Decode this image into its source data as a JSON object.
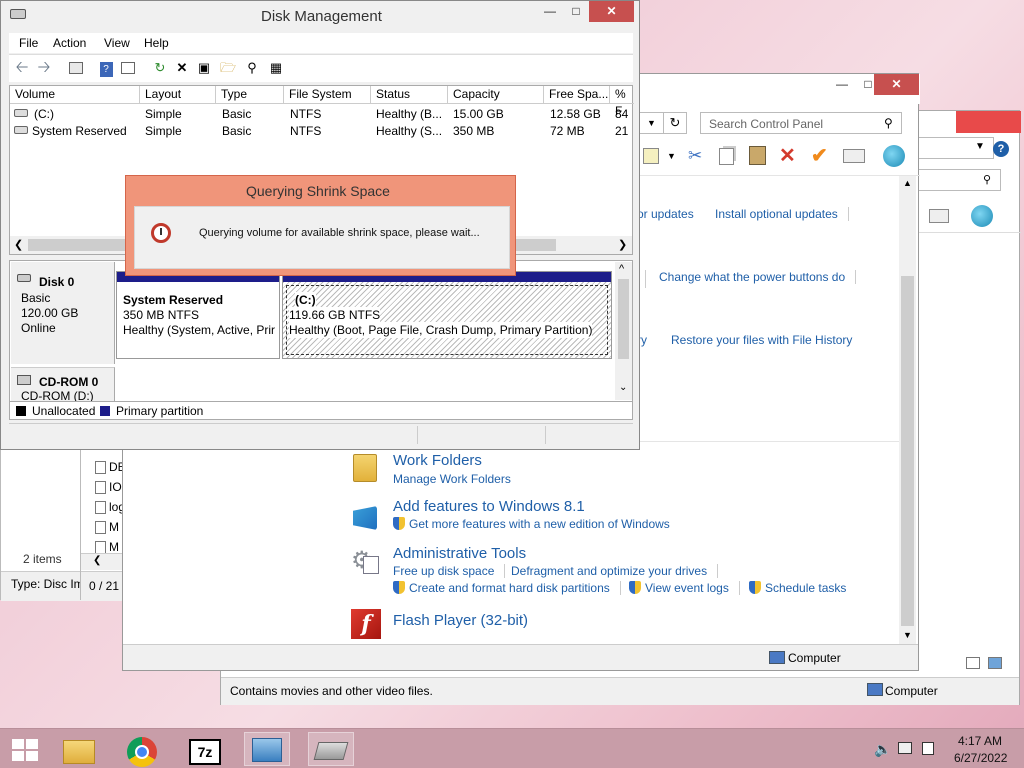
{
  "background_windows": {
    "left_explorer": {
      "items_count": "2 items",
      "type_text": "Type: Disc Im"
    },
    "middle_explorer": {
      "file_labels": [
        "DE",
        "IO",
        "log",
        "M",
        "M"
      ],
      "count_text": "0 / 21"
    },
    "back_control_panel": {
      "status_text": "Contains movies and other video files.",
      "computer_label": "Computer"
    }
  },
  "control_panel": {
    "search_placeholder": "Search Control Panel",
    "links_row1": [
      "or updates",
      "Install optional updates"
    ],
    "link_row2": "Change what the power buttons do",
    "links_row3": [
      "ry",
      "Restore your files with File History"
    ],
    "sections": [
      {
        "title": "Work Folders",
        "links": [
          "Manage Work Folders"
        ]
      },
      {
        "title": "Add features to Windows 8.1",
        "links": [
          "Get more features with a new edition of Windows"
        ]
      },
      {
        "title": "Administrative Tools",
        "links": [
          "Free up disk space",
          "Defragment and optimize your drives",
          "Create and format hard disk partitions",
          "View event logs",
          "Schedule tasks"
        ]
      },
      {
        "title": "Flash Player (32-bit)",
        "links": []
      }
    ],
    "status_computer": "Computer"
  },
  "disk_management": {
    "title": "Disk Management",
    "menu": [
      "File",
      "Action",
      "View",
      "Help"
    ],
    "columns": [
      "Volume",
      "Layout",
      "Type",
      "File System",
      "Status",
      "Capacity",
      "Free Spa...",
      "% F"
    ],
    "volumes": [
      {
        "volume": "(C:)",
        "layout": "Simple",
        "type": "Basic",
        "fs": "NTFS",
        "status": "Healthy (B...",
        "capacity": "15.00 GB",
        "free": "12.58 GB",
        "pct": "84"
      },
      {
        "volume": "System Reserved",
        "layout": "Simple",
        "type": "Basic",
        "fs": "NTFS",
        "status": "Healthy (S...",
        "capacity": "350 MB",
        "free": "72 MB",
        "pct": "21"
      }
    ],
    "disk0": {
      "name": "Disk 0",
      "kind": "Basic",
      "size": "120.00 GB",
      "state": "Online",
      "partitions": [
        {
          "name": "System Reserved",
          "size": "350 MB NTFS",
          "status": "Healthy (System, Active, Prir"
        },
        {
          "name": "(C:)",
          "size": "119.66 GB NTFS",
          "status": "Healthy (Boot, Page File, Crash Dump, Primary Partition)"
        }
      ]
    },
    "cdrom": {
      "name": "CD-ROM 0",
      "sub": "CD-ROM (D:)"
    },
    "legend": [
      "Unallocated",
      "Primary partition"
    ]
  },
  "dialog": {
    "title": "Querying Shrink Space",
    "message": "Querying volume for available shrink space, please wait..."
  },
  "taskbar": {
    "time": "4:17 AM",
    "date": "6/27/2022"
  },
  "colors": {
    "dialog_accent": "#f0957a",
    "primary_partition": "#1d1d8a",
    "link_blue": "#1f5fa8",
    "taskbar": "#c89da8"
  }
}
